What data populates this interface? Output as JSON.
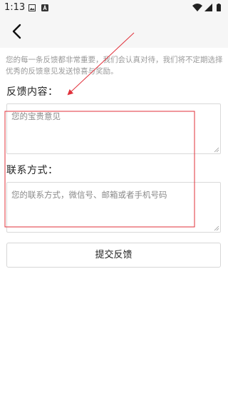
{
  "status_bar": {
    "time": "1:13"
  },
  "app_bar": {
    "back_icon": "back-arrow-icon"
  },
  "intro_text": "您的每一条反馈都非常重要，我们会认真对待，我们将不定期选择优秀的反馈意见发送惊喜与奖励。",
  "feedback": {
    "label": "反馈内容：",
    "placeholder": "您的宝贵意见"
  },
  "contact": {
    "label": "联系方式：",
    "placeholder": "您的联系方式，微信号、邮箱或者手机号码"
  },
  "submit_label": "提交反馈",
  "annotation": {
    "color": "#e0303a"
  }
}
